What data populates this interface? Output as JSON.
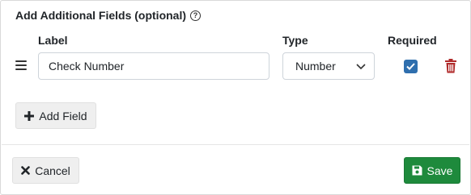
{
  "header": {
    "title": "Add Additional Fields (optional)",
    "help_icon": "question-circle-icon"
  },
  "columns": {
    "label": "Label",
    "type": "Type",
    "required": "Required"
  },
  "fields": [
    {
      "label_value": "Check Number",
      "type_value": "Number",
      "required": true
    }
  ],
  "buttons": {
    "add_field": "Add Field",
    "cancel": "Cancel",
    "save": "Save"
  },
  "colors": {
    "save": "#1e8a3c",
    "checkbox": "#2f6fae",
    "trash": "#b02a2a"
  }
}
